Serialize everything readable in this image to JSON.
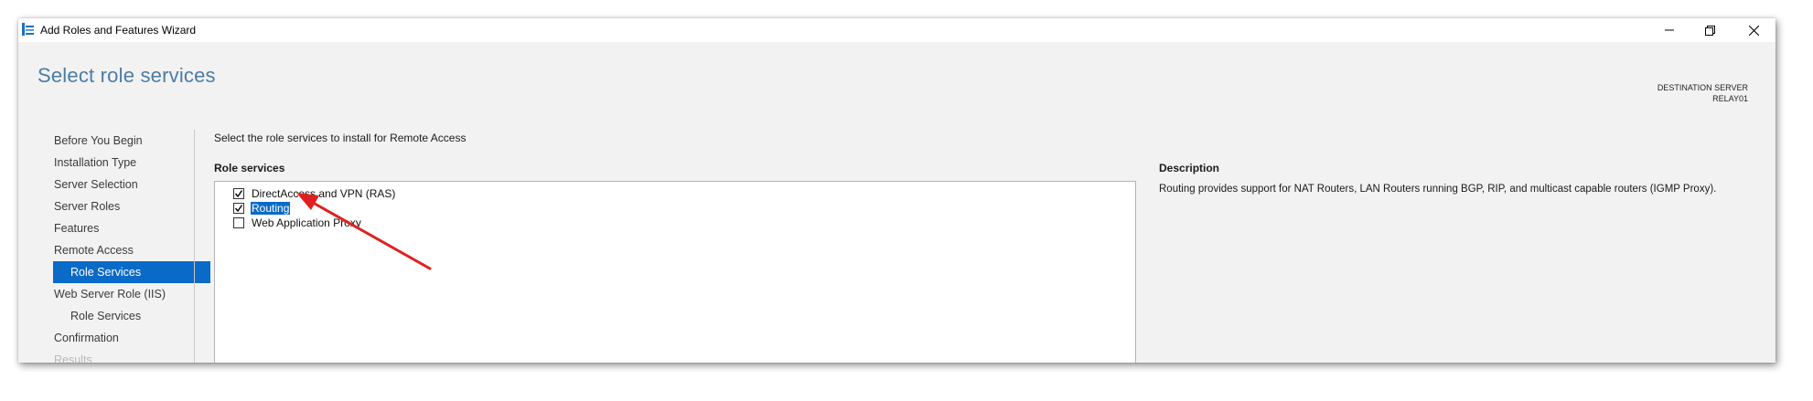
{
  "window": {
    "title": "Add Roles and Features Wizard"
  },
  "page": {
    "title": "Select role services",
    "destination_label": "DESTINATION SERVER",
    "destination_server": "RELAY01"
  },
  "nav": {
    "items": [
      {
        "label": "Before You Begin",
        "level": 0,
        "state": "normal"
      },
      {
        "label": "Installation Type",
        "level": 0,
        "state": "normal"
      },
      {
        "label": "Server Selection",
        "level": 0,
        "state": "normal"
      },
      {
        "label": "Server Roles",
        "level": 0,
        "state": "normal"
      },
      {
        "label": "Features",
        "level": 0,
        "state": "normal"
      },
      {
        "label": "Remote Access",
        "level": 0,
        "state": "normal"
      },
      {
        "label": "Role Services",
        "level": 1,
        "state": "active"
      },
      {
        "label": "Web Server Role (IIS)",
        "level": 0,
        "state": "normal"
      },
      {
        "label": "Role Services",
        "level": 1,
        "state": "normal"
      },
      {
        "label": "Confirmation",
        "level": 0,
        "state": "normal"
      },
      {
        "label": "Results",
        "level": 0,
        "state": "disabled"
      }
    ]
  },
  "main": {
    "instruction": "Select the role services to install for Remote Access",
    "role_services_heading": "Role services",
    "role_services": [
      {
        "label": "DirectAccess and VPN (RAS)",
        "checked": true,
        "selected": false
      },
      {
        "label": "Routing",
        "checked": true,
        "selected": true
      },
      {
        "label": "Web Application Proxy",
        "checked": false,
        "selected": false
      }
    ]
  },
  "description": {
    "heading": "Description",
    "text": "Routing provides support for NAT Routers, LAN Routers running BGP, RIP, and multicast capable routers (IGMP Proxy)."
  },
  "colors": {
    "accent": "#0a6ac8",
    "title": "#4b7ca6",
    "annotation_arrow": "#e02020"
  }
}
